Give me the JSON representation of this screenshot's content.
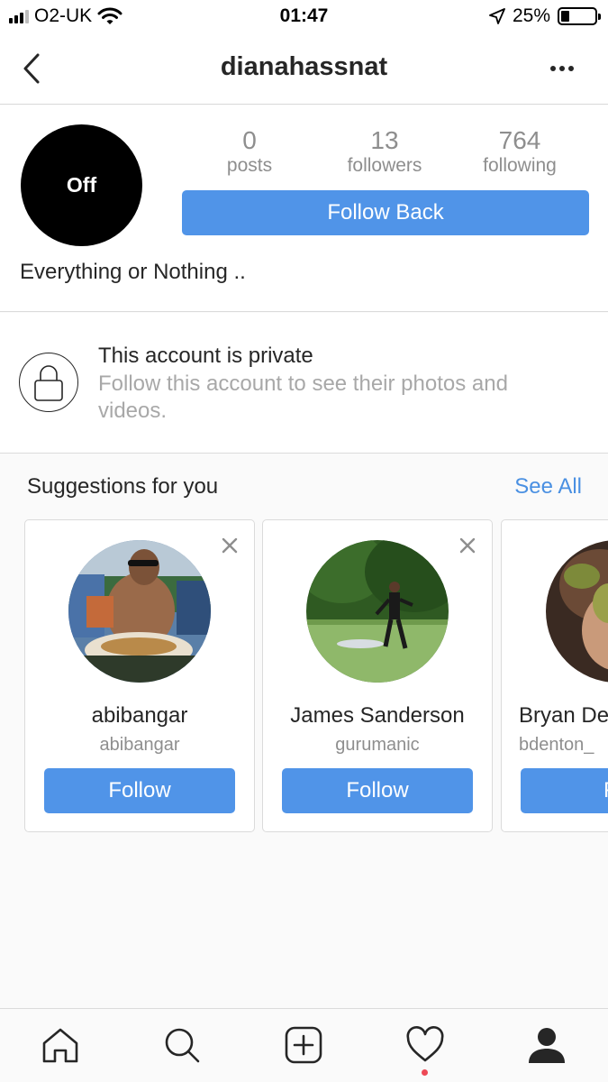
{
  "status_bar": {
    "carrier": "O2-UK",
    "time": "01:47",
    "battery_percent": "25%",
    "battery_level": 0.25,
    "icons": [
      "signal-icon",
      "wifi-icon",
      "location-arrow-icon",
      "battery-icon"
    ]
  },
  "nav": {
    "title": "dianahassnat",
    "back_icon": "chevron-left-icon",
    "more_icon": "more-dots-icon"
  },
  "profile": {
    "avatar_text": "Off",
    "stats": [
      {
        "value": "0",
        "label": "posts"
      },
      {
        "value": "13",
        "label": "followers"
      },
      {
        "value": "764",
        "label": "following"
      }
    ],
    "follow_back_label": "Follow Back",
    "bio": "Everything or Nothing .."
  },
  "private": {
    "icon": "lock-icon",
    "title": "This account is private",
    "subtitle": "Follow this account to see their photos and videos."
  },
  "suggestions": {
    "title": "Suggestions for you",
    "see_all": "See All",
    "cards": [
      {
        "name": "abibangar",
        "username": "abibangar",
        "follow_label": "Follow"
      },
      {
        "name": "James Sanderson",
        "username": "gurumanic",
        "follow_label": "Follow"
      },
      {
        "name": "Bryan De",
        "username": "bdenton_",
        "follow_label": "Fo"
      }
    ]
  },
  "tab_bar": {
    "tabs": [
      "home-icon",
      "search-icon",
      "add-post-icon",
      "activity-heart-icon",
      "profile-icon"
    ],
    "notification_color": "#ed4956"
  },
  "colors": {
    "accent_blue": "#5094e8",
    "link_blue": "#4a90e2"
  }
}
